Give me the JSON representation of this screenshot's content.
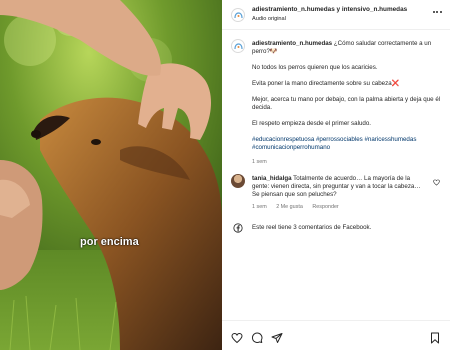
{
  "media": {
    "caption_overlay": "por encima"
  },
  "header": {
    "username": "adiestramiento_n.humedas y intensivo_n.humedas",
    "subtitle": "Audio original",
    "more_icon": "more-horizontal-icon"
  },
  "post": {
    "username": "adiestramiento_n.humedas",
    "intro": "¿Cómo saludar correctamente a un perro?🐶",
    "line1": "No todos los perros quieren que los acaricies.",
    "line2": "Evita poner la mano directamente sobre su cabeza❌",
    "line3": "Mejor, acerca tu mano por debajo, con la palma abierta y deja que él decida.",
    "line4": "El respeto empieza desde el primer saludo.",
    "hashtags": "#educacionrespetuosa #perrossociables #naricesshumedas #comunicacionperrohumano",
    "time": "1 sem"
  },
  "comment": {
    "username": "tania_hidalga",
    "text": "Totalmente de acuerdo… La mayoría de la gente: vienen directa, sin preguntar y van a tocar la cabeza… Se piensan que son peluches?",
    "time": "1 sem",
    "likes": "2 Me gusta",
    "reply": "Responder"
  },
  "facebook_note": "Este reel tiene 3 comentarios de Facebook.",
  "actions": {
    "like_icon": "heart-icon",
    "comment_icon": "comment-icon",
    "share_icon": "share-icon",
    "save_icon": "bookmark-icon"
  },
  "colors": {
    "link": "#00376b",
    "muted": "#737373",
    "text": "#262626"
  }
}
